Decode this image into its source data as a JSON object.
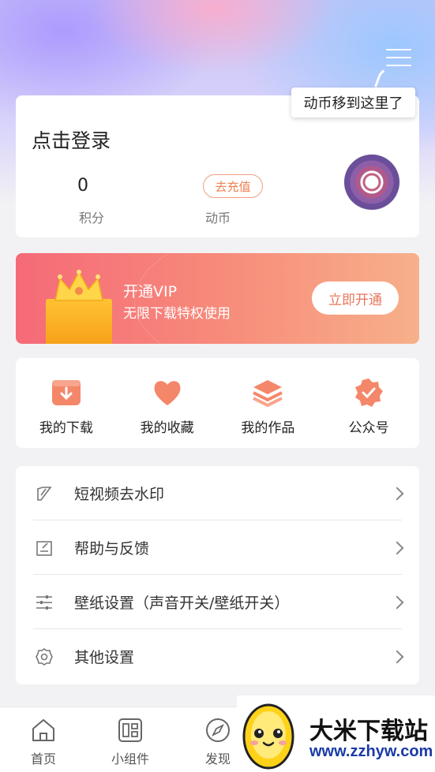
{
  "tooltip": "动币移到这里了",
  "profile": {
    "login_prompt": "点击登录",
    "points_value": "0",
    "points_label": "积分",
    "recharge_button": "去充值",
    "coin_label": "动币"
  },
  "vip": {
    "title": "开通VIP",
    "subtitle": "无限下载特权使用",
    "button": "立即开通"
  },
  "shortcuts": [
    {
      "label": "我的下载",
      "icon": "download-box-icon"
    },
    {
      "label": "我的收藏",
      "icon": "heart-icon"
    },
    {
      "label": "我的作品",
      "icon": "layers-icon"
    },
    {
      "label": "公众号",
      "icon": "verified-badge-icon"
    }
  ],
  "settings": [
    {
      "label": "短视频去水印",
      "icon": "brush-icon"
    },
    {
      "label": "帮助与反馈",
      "icon": "edit-note-icon"
    },
    {
      "label": "壁纸设置（声音开关/壁纸开关）",
      "icon": "sliders-icon"
    },
    {
      "label": "其他设置",
      "icon": "gear-icon"
    }
  ],
  "tabs": [
    {
      "label": "首页",
      "icon": "home-icon"
    },
    {
      "label": "小组件",
      "icon": "widget-icon"
    },
    {
      "label": "发现",
      "icon": "compass-icon"
    }
  ],
  "watermark": {
    "title": "大米下载站",
    "url": "www.zzhyw.com"
  },
  "colors": {
    "accent": "#f08050",
    "vip_start": "#f56a78",
    "vip_end": "#f7b08a",
    "icon_orange": "#f4876a"
  }
}
